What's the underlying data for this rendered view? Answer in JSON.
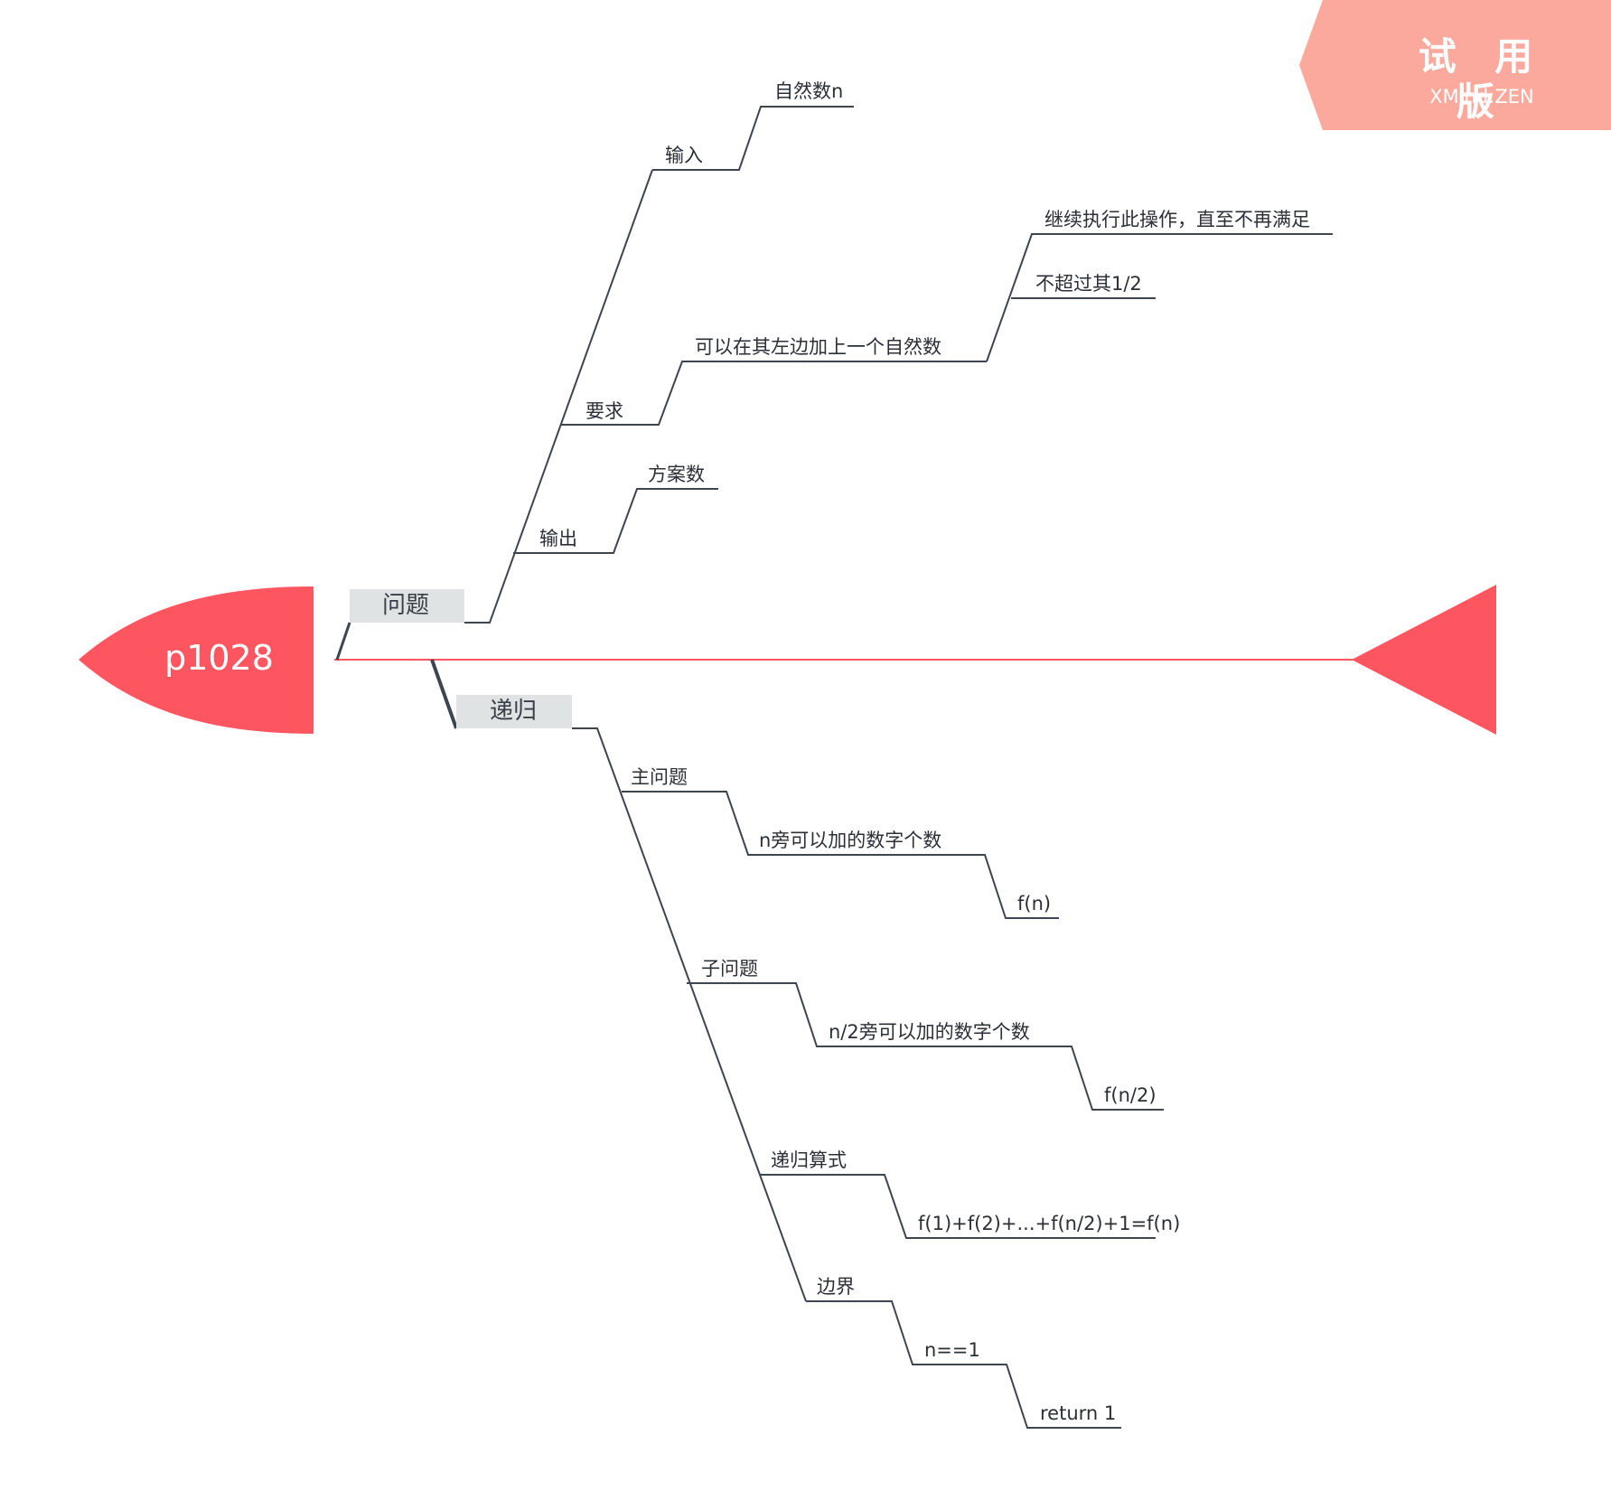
{
  "watermark": {
    "title": "试 用 版",
    "subtitle": "XMind:ZEN"
  },
  "colors": {
    "accent": "#fe5660",
    "badge": "#fba99d",
    "line": "#3d4550",
    "topic_fill": "#dfe3e3"
  },
  "root": {
    "label": "p1028"
  },
  "branches": {
    "problem": {
      "label": "问题",
      "input": {
        "label": "输入",
        "child": "自然数n"
      },
      "requirement": {
        "label": "要求",
        "child": "可以在其左边加上一个自然数",
        "grandchildren": [
          "继续执行此操作，直至不再满足",
          "不超过其1/2"
        ]
      },
      "output": {
        "label": "输出",
        "child": "方案数"
      }
    },
    "recursion": {
      "label": "递归",
      "main_problem": {
        "label": "主问题",
        "child": "n旁可以加的数字个数",
        "grandchild": "f(n)"
      },
      "sub_problem": {
        "label": "子问题",
        "child": "n/2旁可以加的数字个数",
        "grandchild": "f(n/2)"
      },
      "formula": {
        "label": "递归算式",
        "child": "f(1)+f(2)+...+f(n/2)+1=f(n)"
      },
      "boundary": {
        "label": "边界",
        "child": "n==1",
        "grandchild": "return 1"
      }
    }
  }
}
